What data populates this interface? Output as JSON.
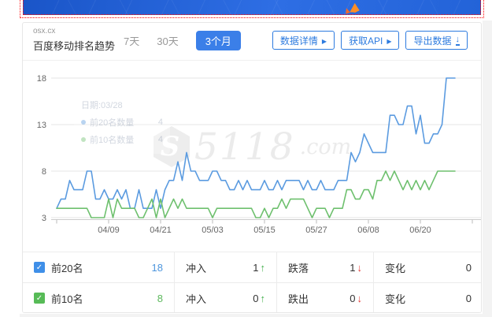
{
  "colors": {
    "accent_blue": "#2d7bdf",
    "tab_active_bg": "#3b7fe8",
    "line_top20": "#5b9be0",
    "line_top10": "#6ec06e",
    "arrow_up": "#3fae49",
    "arrow_down": "#e53935",
    "banner_blue": "#2363d8",
    "banner_flame_orange": "#ff8e26",
    "selection_dotted_red": "#ff0000",
    "watermark_gray": "#ebebeb"
  },
  "header": {
    "domain": "osx.cx",
    "title": "百度移动排名趋势",
    "tabs": [
      {
        "label": "7天",
        "active": false
      },
      {
        "label": "30天",
        "active": false
      },
      {
        "label": "3个月",
        "active": true
      }
    ],
    "actions": [
      {
        "label": "数据详情",
        "icon": "play-icon"
      },
      {
        "label": "获取API",
        "icon": "play-icon"
      },
      {
        "label": "导出数据",
        "icon": "download-icon"
      }
    ]
  },
  "watermark": {
    "logo_letter": "S",
    "text": "5118",
    "suffix": ".com"
  },
  "tooltip": {
    "date": "日期:03/28",
    "rows": [
      {
        "label": "前20名数量",
        "value": "4"
      },
      {
        "label": "前10名数量",
        "value": "4"
      }
    ]
  },
  "chart_data": {
    "type": "line",
    "title": "百度移动排名趋势 (3个月)",
    "x_start_date": "03/28",
    "x_tick_labels": [
      "04/09",
      "04/21",
      "05/03",
      "05/15",
      "05/27",
      "06/08",
      "06/20"
    ],
    "y_ticks": [
      3,
      8,
      13,
      18
    ],
    "ylim": [
      3,
      18.5
    ],
    "grid": true,
    "legend_position": "table-below",
    "series": [
      {
        "name": "前20名",
        "color": "#5b9be0",
        "values": [
          4,
          5,
          5,
          7,
          6,
          6,
          6,
          8,
          8,
          5,
          5,
          6,
          5,
          5,
          6,
          5,
          6,
          4,
          4,
          6,
          4,
          4,
          4,
          6,
          4,
          6,
          7,
          7,
          9,
          7,
          10,
          8,
          8,
          7,
          7,
          7,
          8,
          8,
          7,
          7,
          6,
          6,
          7,
          6,
          7,
          6,
          6,
          6,
          7,
          6,
          6,
          7,
          6,
          7,
          7,
          7,
          7,
          6,
          7,
          6,
          6,
          7,
          6,
          6,
          6,
          7,
          7,
          7,
          10,
          9,
          10,
          12,
          11,
          10,
          10,
          10,
          10,
          14,
          14,
          13,
          13,
          15,
          15,
          12,
          14,
          11,
          11,
          12,
          12,
          13,
          18,
          18,
          18
        ]
      },
      {
        "name": "前10名",
        "color": "#6ec06e",
        "values": [
          4,
          4,
          4,
          4,
          4,
          4,
          4,
          4,
          3,
          3,
          3,
          3,
          5,
          3,
          5,
          4,
          4,
          4,
          4,
          3,
          3,
          4,
          5,
          3,
          5,
          3,
          4,
          5,
          4,
          5,
          4,
          4,
          4,
          4,
          4,
          4,
          3,
          4,
          4,
          4,
          4,
          4,
          4,
          4,
          4,
          4,
          3,
          3,
          4,
          3,
          4,
          4,
          5,
          4,
          5,
          5,
          5,
          5,
          4,
          3,
          4,
          4,
          4,
          3,
          4,
          4,
          4,
          6,
          6,
          5,
          5,
          6,
          6,
          5,
          7,
          7,
          8,
          7,
          8,
          7,
          6,
          7,
          6,
          7,
          6,
          7,
          6,
          7,
          8,
          8,
          8,
          8,
          8
        ]
      }
    ]
  },
  "table": {
    "rows": [
      {
        "series": "前20名",
        "total": "18",
        "c2_label": "冲入",
        "c2_value": "1",
        "c2_arrow": "↑",
        "c3_label": "跌落",
        "c3_value": "1",
        "c3_arrow": "↓",
        "c4_label": "变化",
        "c4_value": "0"
      },
      {
        "series": "前10名",
        "total": "8",
        "c2_label": "冲入",
        "c2_value": "0",
        "c2_arrow": "↑",
        "c3_label": "跌出",
        "c3_value": "0",
        "c3_arrow": "↓",
        "c4_label": "变化",
        "c4_value": "0"
      }
    ]
  }
}
